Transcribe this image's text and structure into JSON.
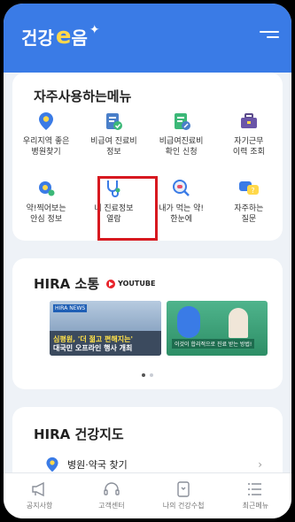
{
  "header": {
    "logo_text": "건강",
    "logo_e": "e",
    "logo_suffix": "음",
    "menu_icon": "hamburger-menu-icon"
  },
  "frequent_menu": {
    "title": "자주사용하는메뉴",
    "items": [
      {
        "label": "우리지역 좋은\n병원찾기",
        "icon": "location-pin-icon"
      },
      {
        "label": "비급여 진료비\n정보",
        "icon": "document-check-icon"
      },
      {
        "label": "비급여진료비\n확인 신청",
        "icon": "document-edit-icon"
      },
      {
        "label": "자기근무\n이력 조회",
        "icon": "briefcase-icon"
      },
      {
        "label": "약!찍어보는\n안심 정보",
        "icon": "pill-search-icon"
      },
      {
        "label": "내 진료정보\n열람",
        "icon": "stethoscope-icon"
      },
      {
        "label": "내가 먹는 약!\n한눈에",
        "icon": "pill-magnify-icon"
      },
      {
        "label": "자주하는\n질문",
        "icon": "chat-question-icon"
      }
    ]
  },
  "hira_sotong": {
    "title": "HIRA 소통",
    "youtube_label": "YOUTUBE",
    "video1_badge": "HIRA NEWS",
    "video1_caption_line1": "심평원, '더 젊고 편해지는'",
    "video1_caption_line2": "대국민 오프라인 행사 개최",
    "video2_caption": "이것이 합리적으로 진료 받는 방법!"
  },
  "health_map": {
    "title": "HIRA 건강지도",
    "row_label": "병원·약국 찾기",
    "row_icon": "location-pin-icon"
  },
  "bottom_nav": [
    {
      "label": "공지사항",
      "icon": "megaphone-icon"
    },
    {
      "label": "고객센터",
      "icon": "headset-icon"
    },
    {
      "label": "나의 건강수첩",
      "icon": "notebook-icon"
    },
    {
      "label": "최근메뉴",
      "icon": "list-icon"
    }
  ],
  "colors": {
    "brand_blue": "#3a7be6",
    "highlight_red": "#d71920"
  }
}
